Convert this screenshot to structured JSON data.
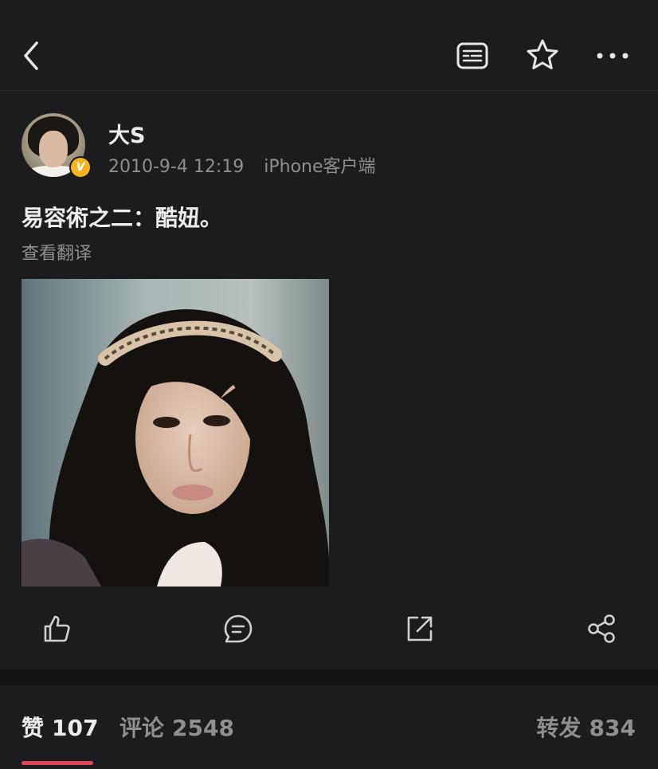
{
  "post": {
    "author": "大S",
    "timestamp": "2010-9-4 12:19",
    "source": "iPhone客户端",
    "verified_badge": "V",
    "text": "易容術之二：酷妞。",
    "translate_link": "查看翻译"
  },
  "stats": {
    "likes_label": "赞",
    "likes_count": "107",
    "comments_label": "评论",
    "comments_count": "2548",
    "reposts_label": "转发",
    "reposts_count": "834"
  },
  "icons": {
    "back": "back-chevron-icon",
    "reader": "reader-icon",
    "favorite": "star-icon",
    "more": "more-icon",
    "like": "thumbs-up-icon",
    "comment": "comment-icon",
    "repost": "repost-icon",
    "share": "share-icon"
  },
  "colors": {
    "background": "#1c1c1e",
    "accent_underline": "#e2445a",
    "badge": "#f4b323"
  }
}
